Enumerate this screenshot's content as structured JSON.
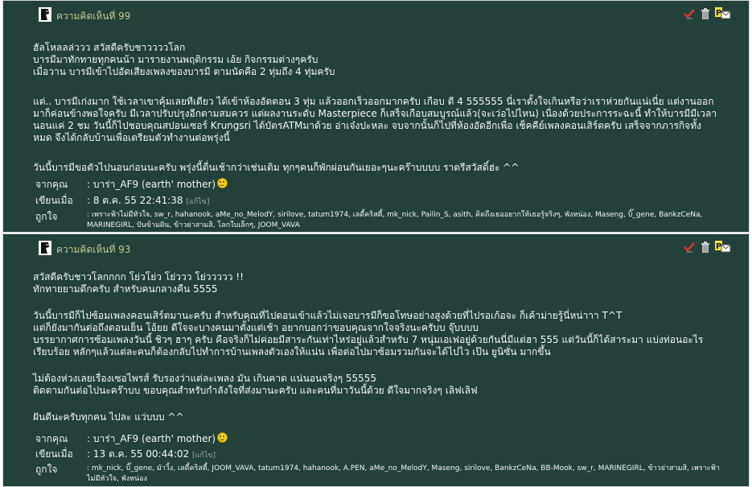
{
  "comments": [
    {
      "title": "ความคิดเห็นที่ 99",
      "lines": [
        "ฮัลโหลลล่ววว สวัสดีครับชาววววโลก",
        "บารมีมาทักทายทุกคนน้า มารายงานพฤติกรรม เอ้ย กิจกรรมต่างๆครับ",
        "เมื่อวาน บารมีเข้าไปอัดเสียงเพลงของบารมี ตามนัดคือ 2 ทุ่มถึง 4 ทุ่มครับ",
        "",
        "แต่.. บารมีเก่งมาก ใช้เวลาเขาคุ้มเลยทีเดียว ได้เข้าห้องอัดตอน 3 ทุ่ม แล้วออกเร็วออกมากครับ เกือบ ตี 4 555555 นี่เราตั้งใจเกินหรือว่าเราห่วยกันแน่เนี่ย แต่งานออก",
        "มาก็ค่อนข้างพอใจครับ มีเวลาปรับปรุงอีกตามสมควร แต่ผลงานระดับ Masterpiece ก็เสร็จเกือบสมบูรณ์แล้ว(จะเว่อไปไหน) เนื่องด้วยประการระฉะนี้ ทำให้บารมีมีเวลา",
        "นอนแค่ 2 ชม วันนี้ก็ไปชอบคุณสปอนเซอร์ Krungsri ได้บัตรATMมาด้วย อ่าเจ๋งปะหละ จบจากนั้นก็ไปที่ห้องอัดอีกเพื่อ เช็คคีย์เพลงคอนเสิร์ตครับ เสร็จจากภารกิจทั้ง",
        "หมด จึงได้กลับบ้านเพื่อเตรียมตัวทำงานต่อพรุ่งนี้",
        "",
        "วันนี้บารมีขอตัวไปนอนก่อนนะครับ พรุ่งนี้ตื่นเช้ากว่าเช่นเดิม ทุกๆคนก็พักผ่อนกันเยอะๆนะคร๊าบบบบ ราตรีสวัสดิ์ฮ่ะ ^^"
      ],
      "from_label": "จากคุณ",
      "from_value": ": บาร่า_AF9 (earth' mother)",
      "date_label": "เขียนเมื่อ",
      "date_value": ": 8 ต.ค. 55 22:41:38",
      "edit_label": "[แก้ไข]",
      "likes_label": "ถูกใจ",
      "likes_value": ": เพราะฟ้าไม่มีหัวใจ, sw_r, hahanook, aMe_no_MelodY, sirilove, tatum1974, เลดี้คริสตี้, mk_nick, Pailin_S, asith, คิดถึงเธออยากให้เธอรู้จริงๆ, พังหน่อง, Maseng, บิ๊_gene, BankzCeNa, MARINEGIRL, ปันข้ามฝัน, ข้าวย่าสามสิ, โลกใบเล็กๆ, JOOM_VAVA"
    },
    {
      "title": "ความคิดเห็นที่ 93",
      "lines": [
        "สวัสดีครับชาวโลกกกก โย่วโย่ว โย่ววว โย่ววววว !!",
        "ทักทายยามดึกครับ สำหรับคนกลางคืน 5555",
        "",
        "วันนี้บารมีก็ไปซ้อมเพลงคอนเสิร์ตมานะครับ สำหรับคุณที่ไปดอนเข้าแล้วไม่เจอบารมีก็ขอโทษอย่างสูงด้วยที่ไปรอเก้อจะ ก็เค้าม่ายรู้นี่หน่าาา T^T",
        "แต่ก็ยังมากันต่อถึงตอนเย็น โอ้ยย ดีใจจะบางคนมาตั้งแต่เช้า อยากบอกว่าขอบคุณจากใจจริงนะครับบ จุ๊บบบบ",
        "บรรยากาศการซ้อมเพลงวันนี้ ชิวๆ ฮาๆ ครับ คือจริงก็ไม่ค่อยมีสาระกันเท่าไหร่อยู่แล้วสำหรับ 7 หนุ่มเอเฟอยู่ด้วยกันนี่มีแต่ฮา 555 แต่วันนี้ก็ได้สาระมา แบ่งท่อนอะไร",
        "เรียบร้อย หลักๆแล้วแต่ละคนก็ต้องกลับไปทำการบ้านเพลงตัวเองให้แน่น เพื่อต่อไปมาซ้อมรวมกันจะได้ไปไว เป๊น ยูนิซั่น มากขึ้น",
        "",
        "ไม่ต้องห่วงเลยเรื่องเซอไพรส์ รับรองว่าแต่ละเพลง มัน เกินคาด แน่นอนจริงๆ 55555",
        "ติดตามกันต่อไปนะคร๊าบบ ขอบคุณสำหรับกำลังใจที่ส่งมานะครับ และคนที่มาวันนี้ด้วย ดีใจมากจริงๆ เลิฟเลิฟ",
        "",
        "ฝันดีนะครับทุกคน ไปละ แว่บบบ ^^"
      ],
      "from_label": "จากคุณ",
      "from_value": ": บาร่า_AF9 (earth' mother)",
      "date_label": "เขียนเมื่อ",
      "date_value": ": 13 ต.ค. 55 00:44:02",
      "edit_label": "[แก้ไข]",
      "likes_label": "ถูกใจ",
      "likes_value": ": mk_nick, บิ๊_gene, มัาวิ้ง, เลดี้คริสตี้, JOOM_VAVA, tatum1974, hahanook, A.PEN, aMe_no_MelodY, Maseng, sirilove, BankzCeNa, BB-Mook, sw_r, MARINEGIRL, ข้าวย่าสามสิ, เพราะฟ้าไม่มีหัวใจ, พังหน่อง"
    }
  ],
  "icons": {
    "avatar": "user-avatar-icon",
    "like": "like-check-icon",
    "delete": "trash-icon",
    "reply": "reply-mail-icon"
  },
  "colors": {
    "panel_bg": "#24403b",
    "title": "#c7c98b",
    "border": "#d7d7d7"
  }
}
